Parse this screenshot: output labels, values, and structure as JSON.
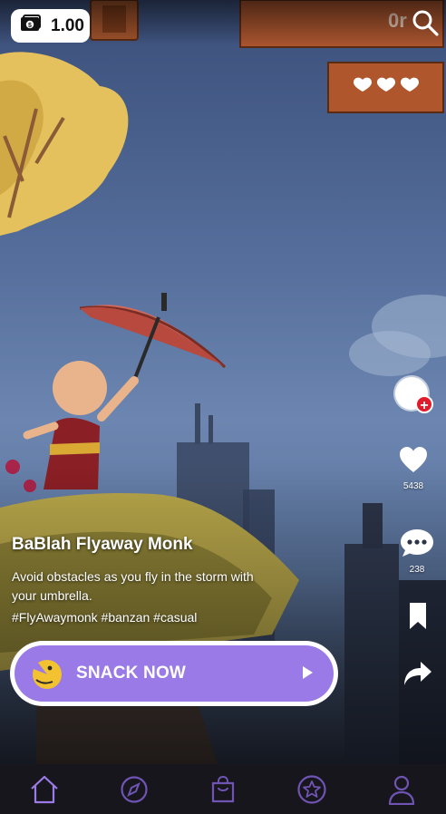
{
  "wallet": {
    "amount": "1.00",
    "icon": "wallet-icon"
  },
  "hud": {
    "hearts": 3,
    "score_text": "0r"
  },
  "game": {
    "title": "BaBlah Flyaway Monk",
    "description": "Avoid obstacles as you fly in the storm with your umbrella.",
    "tags": "#FlyAwaymonk #banzan #casual"
  },
  "actions": {
    "likes": "5438",
    "comments": "238"
  },
  "cta": {
    "label": "SNACK NOW"
  },
  "tabs": [
    {
      "name": "home",
      "icon": "home-icon",
      "active": true
    },
    {
      "name": "explore",
      "icon": "compass-icon"
    },
    {
      "name": "shop",
      "icon": "shopping-bag-icon"
    },
    {
      "name": "favorites",
      "icon": "star-icon"
    },
    {
      "name": "profile",
      "icon": "user-icon"
    }
  ],
  "colors": {
    "accent": "#9a7ae6",
    "tab_active": "#9b7be6",
    "tab_inactive": "#6f54b3",
    "follow": "#e21b2c"
  }
}
